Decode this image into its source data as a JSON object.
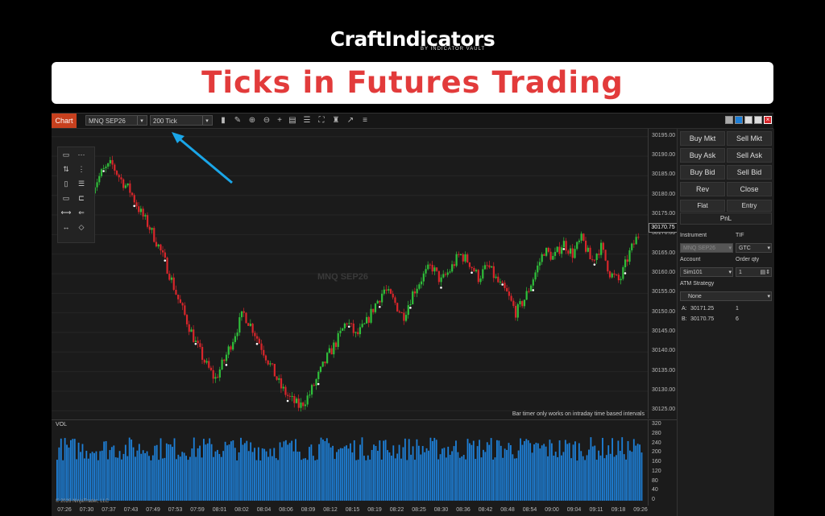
{
  "header": {
    "brand": "CraftIndicators",
    "brand_sub": "BY INDICATOR VAULT",
    "banner_title": "Ticks in Futures Trading"
  },
  "toolbar": {
    "chart_tab": "Chart",
    "instrument_value": "MNQ SEP26",
    "interval_value": "200 Tick",
    "icons": [
      "bar-type-icon",
      "pencil-draw-icon",
      "zoom-in-icon",
      "zoom-out-icon",
      "crosshair-icon",
      "data-box-icon",
      "properties-icon",
      "screenshot-icon",
      "strategies-icon",
      "indicators-icon",
      "templates-icon"
    ]
  },
  "chart": {
    "watermark": "MNQ SEP26",
    "bar_timer_note": "Bar timer only works on intraday time based intervals",
    "current_price": "30170.75",
    "price_labels": [
      "30195.00",
      "30190.00",
      "30185.00",
      "30180.00",
      "30175.00",
      "30170.00",
      "30165.00",
      "30160.00",
      "30155.00",
      "30150.00",
      "30145.00",
      "30140.00",
      "30135.00",
      "30130.00",
      "30125.00"
    ],
    "volume_title": "VOL",
    "volume_labels": [
      "320",
      "280",
      "240",
      "200",
      "160",
      "120",
      "80",
      "40",
      "0"
    ],
    "copyright": "© 2026 NinjaTrader, LLC",
    "time_labels": [
      "07:26",
      "07:30",
      "07:37",
      "07:43",
      "07:49",
      "07:53",
      "07:59",
      "08:01",
      "08:02",
      "08:04",
      "08:06",
      "08:09",
      "08:12",
      "08:15",
      "08:19",
      "08:22",
      "08:25",
      "08:30",
      "08:36",
      "08:42",
      "08:48",
      "08:54",
      "09:00",
      "09:04",
      "09:11",
      "09:18",
      "09:26"
    ],
    "colors": {
      "up": "#2fbf3a",
      "down": "#d8262b",
      "volume": "#1e7fd6",
      "arrow": "#1aa6e8"
    }
  },
  "chart_data": {
    "type": "candlestick",
    "instrument": "MNQ SEP26",
    "interval": "200 Tick",
    "ylim": [
      30123,
      30197
    ],
    "close_path": [
      30182,
      30186,
      30188,
      30184,
      30181,
      30176,
      30172,
      30167,
      30161,
      30154,
      30148,
      30142,
      30137,
      30133,
      30138,
      30144,
      30150,
      30146,
      30141,
      30136,
      30131,
      30128,
      30126,
      30129,
      30134,
      30139,
      30143,
      30148,
      30144,
      30147,
      30152,
      30156,
      30153,
      30149,
      30155,
      30159,
      30162,
      30158,
      30161,
      30165,
      30163,
      30159,
      30162,
      30158,
      30155,
      30150,
      30154,
      30160,
      30166,
      30164,
      30168,
      30165,
      30169,
      30163,
      30167,
      30160,
      30158,
      30165,
      30170
    ],
    "volume_range": [
      0,
      320
    ]
  },
  "panel": {
    "buttons": [
      [
        "Buy Mkt",
        "Sell Mkt"
      ],
      [
        "Buy Ask",
        "Sell Ask"
      ],
      [
        "Buy Bid",
        "Sell Bid"
      ],
      [
        "Rev",
        "Close"
      ]
    ],
    "flat": "Flat",
    "entry": "Entry",
    "pnl": "PnL",
    "instrument_label": "Instrument",
    "instrument_value": "MNQ SEP26",
    "tif_label": "TIF",
    "tif_value": "GTC",
    "account_label": "Account",
    "account_value": "Sim101",
    "order_qty_label": "Order qty",
    "order_qty_value": "1",
    "atm_label": "ATM Strategy",
    "atm_value": "None",
    "ask_label": "A:",
    "ask_price": "30171.25",
    "ask_size": "1",
    "bid_label": "B:",
    "bid_price": "30170.75",
    "bid_size": "6"
  }
}
